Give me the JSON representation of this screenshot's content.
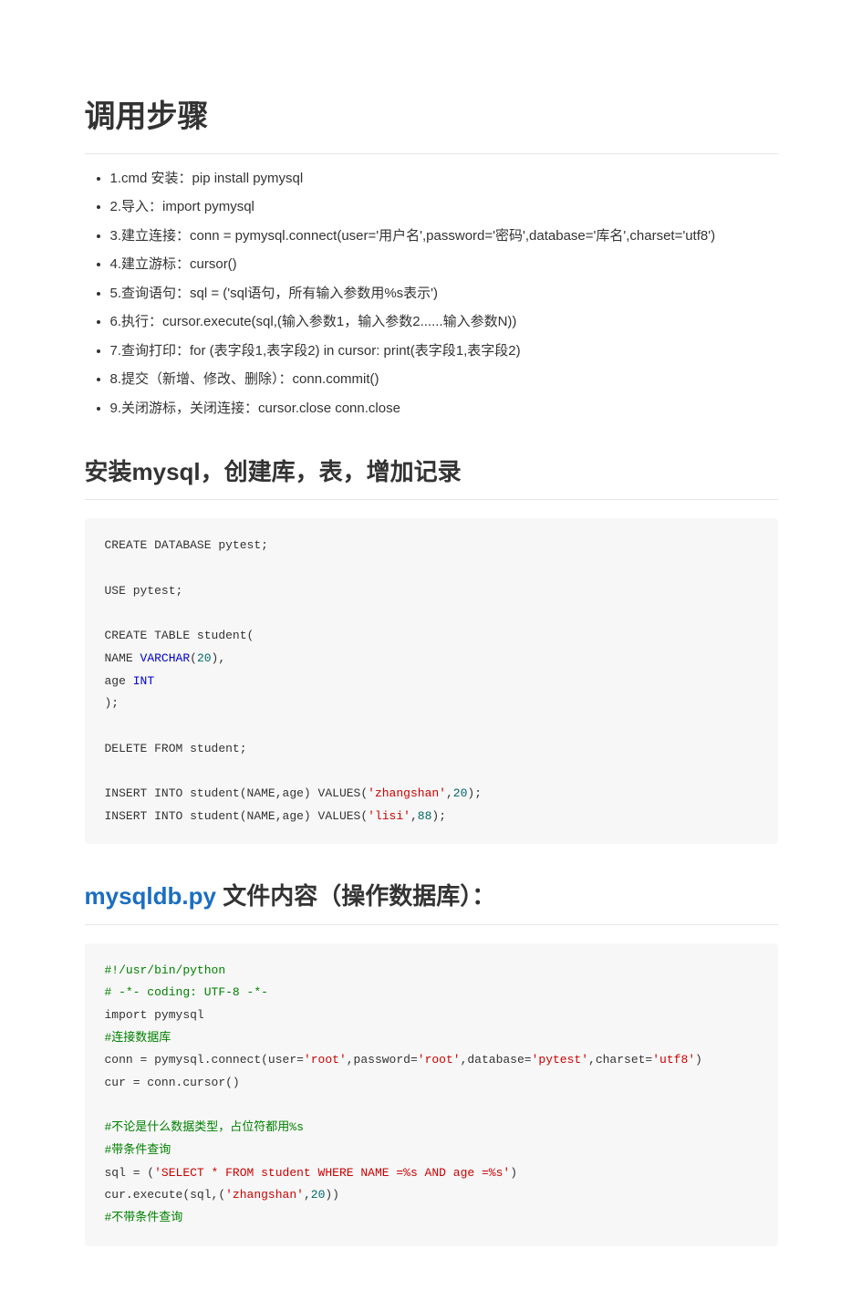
{
  "h1": "调用步骤",
  "steps": [
    "1.cmd 安装：pip install pymysql",
    "2.导入：import pymysql",
    "3.建立连接：conn = pymysql.connect(user='用户名',password='密码',database='库名',charset='utf8')",
    "4.建立游标：cursor()",
    "5.查询语句：sql = ('sql语句，所有输入参数用%s表示')",
    "6.执行：cursor.execute(sql,(输入参数1，输入参数2......输入参数N))",
    "7.查询打印：for (表字段1,表字段2) in cursor: print(表字段1,表字段2)",
    "8.提交（新增、修改、删除）：conn.commit()",
    "9.关闭游标，关闭连接：cursor.close conn.close"
  ],
  "h2_1": "安装mysql，创建库，表，增加记录",
  "code1": {
    "l1": "CREATE DATABASE pytest;",
    "l2": "",
    "l3": "USE pytest;",
    "l4": "",
    "l5a": "CREATE TABLE student(",
    "l6a": "NAME ",
    "l6b": "VARCHAR",
    "l6c": "(",
    "l6d": "20",
    "l6e": "),",
    "l7a": "age ",
    "l7b": "INT",
    "l8": ");",
    "l9": "",
    "l10": "DELETE FROM student;",
    "l11": "",
    "l12a": "INSERT INTO student(NAME,age) VALUES(",
    "l12b": "'zhangshan'",
    "l12c": ",",
    "l12d": "20",
    "l12e": ");",
    "l13a": "INSERT INTO student(NAME,age) VALUES(",
    "l13b": "'lisi'",
    "l13c": ",",
    "l13d": "88",
    "l13e": ");"
  },
  "h2_2_link": "mysqldb.py",
  "h2_2_rest": " 文件内容（操作数据库）：",
  "code2": {
    "c1": "#!/usr/bin/python",
    "c2": "# -*- coding: UTF-8 -*-",
    "l3": "import pymysql",
    "c4": "#连接数据库",
    "l5a": "conn = pymysql.connect(user=",
    "l5b": "'root'",
    "l5c": ",password=",
    "l5d": "'root'",
    "l5e": ",database=",
    "l5f": "'pytest'",
    "l5g": ",charset=",
    "l5h": "'utf8'",
    "l5i": ")",
    "l6": "cur = conn.cursor()",
    "l7": "",
    "c8": "#不论是什么数据类型，占位符都用%s",
    "c9": "#带条件查询",
    "l10a": "sql = (",
    "l10b": "'SELECT * FROM student WHERE NAME =%s AND age =%s'",
    "l10c": ")",
    "l11a": "cur.execute(sql,(",
    "l11b": "'zhangshan'",
    "l11c": ",",
    "l11d": "20",
    "l11e": "))",
    "c12": "#不带条件查询"
  }
}
